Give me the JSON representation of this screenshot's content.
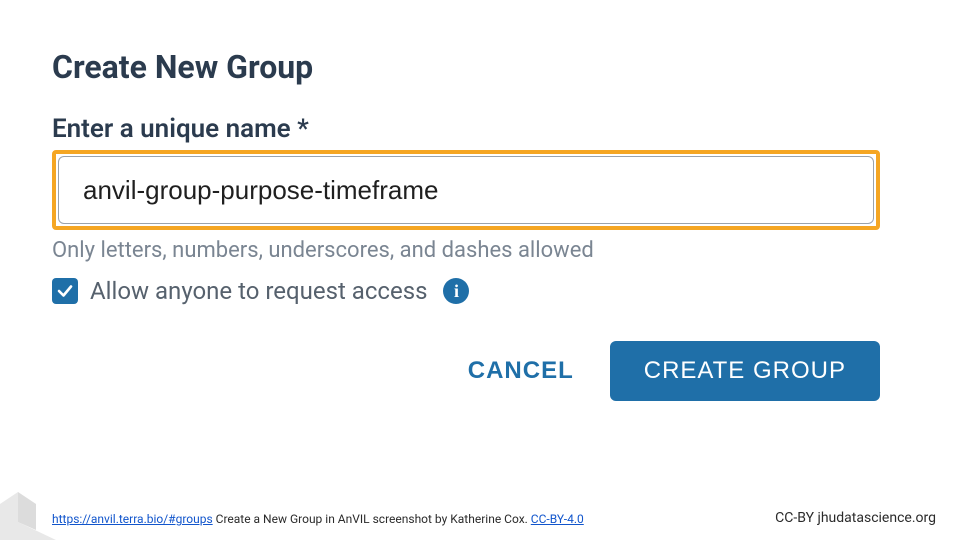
{
  "dialog": {
    "title": "Create New Group",
    "name_label": "Enter a unique name *",
    "name_value": "anvil-group-purpose-timeframe",
    "name_helper": "Only letters, numbers, underscores, and dashes allowed",
    "allow_request_label": "Allow anyone to request access",
    "allow_request_checked": true,
    "cancel_label": "CANCEL",
    "create_label": "CREATE GROUP"
  },
  "footer": {
    "url_text": "https://anvil.terra.bio/#groups",
    "caption_mid": " Create a New Group in AnVIL screenshot by Katherine Cox.  ",
    "license_text": "CC-BY-4.0",
    "right_text": "CC-BY  jhudatascience.org"
  },
  "colors": {
    "accent": "#1f6fa8",
    "highlight": "#f5a623",
    "title": "#2b3b4e",
    "muted": "#7a8592"
  }
}
